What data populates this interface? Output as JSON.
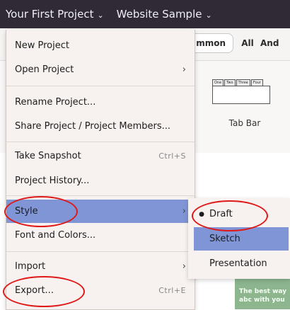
{
  "topbar": {
    "project_name": "Your First Project",
    "page_name": "Website Sample"
  },
  "background": {
    "segments": [
      "mmon",
      "All",
      "And"
    ],
    "component_label": "Tab Bar",
    "tab_preview": [
      "One",
      "Two",
      "Three",
      "Four"
    ],
    "card_text_1": "The best way",
    "card_text_2": "abc with you"
  },
  "menu": {
    "items": [
      {
        "label": "New Project",
        "shortcut": "",
        "submenu": false
      },
      {
        "label": "Open Project",
        "shortcut": "",
        "submenu": true
      },
      {
        "label": "Rename Project...",
        "shortcut": "",
        "submenu": false
      },
      {
        "label": "Share Project / Project Members...",
        "shortcut": "",
        "submenu": false
      },
      {
        "label": "Take Snapshot",
        "shortcut": "Ctrl+S",
        "submenu": false
      },
      {
        "label": "Project History...",
        "shortcut": "",
        "submenu": false
      },
      {
        "label": "Style",
        "shortcut": "",
        "submenu": true
      },
      {
        "label": "Font and Colors...",
        "shortcut": "",
        "submenu": false
      },
      {
        "label": "Import",
        "shortcut": "",
        "submenu": true
      },
      {
        "label": "Export...",
        "shortcut": "Ctrl+E",
        "submenu": false
      }
    ],
    "arrow_glyph": "›",
    "chevron_glyph": "⌄"
  },
  "style_submenu": {
    "items": [
      {
        "label": "Draft",
        "selected": true
      },
      {
        "label": "Sketch",
        "selected": false
      },
      {
        "label": "Presentation",
        "selected": false
      }
    ],
    "bullet_glyph": "●"
  },
  "colors": {
    "topbar_bg": "#2f2a36",
    "menu_bg": "#f7f2ef",
    "highlight": "#7f95d6",
    "annotation": "#e01818"
  }
}
